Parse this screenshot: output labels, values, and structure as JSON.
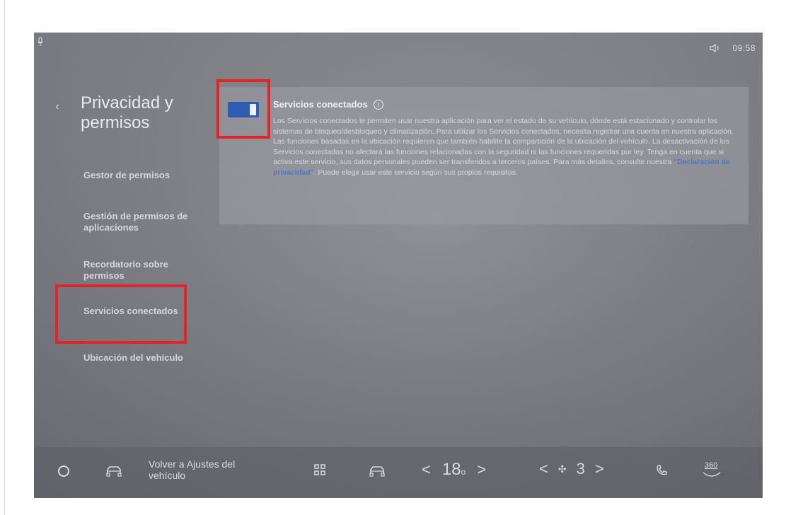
{
  "status": {
    "time": "09:58"
  },
  "sidebar": {
    "title": "Privacidad y permisos",
    "items": [
      {
        "label": "Gestor de permisos"
      },
      {
        "label": "Gestión de permisos de aplicaciones"
      },
      {
        "label": "Recordatorio sobre permisos"
      },
      {
        "label": "Servicios conectados"
      },
      {
        "label": "Ubicación del vehículo"
      }
    ]
  },
  "content": {
    "title": "Servicios conectados",
    "toggle_state": true,
    "description_before": "Los Servicios conectados le permiten usar nuestra aplicación para ver el estado de su vehículo, dónde está estacionado y controlar los sistemas de bloqueo/desbloqueo y climatización. Para utilizar los Servicios conectados, necesita registrar una cuenta en nuestra aplicación. Las funciones basadas en la ubicación requieren que también habilite la compartición de la ubicación del vehículo. La desactivación de los Servicios conectados no afectará las funciones relacionadas con la seguridad ni las funciones requeridas por ley. Tenga en cuenta que si activa este servicio, sus datos personales pueden ser transferidos a terceros países. Para más detalles, consulte nuestra ",
    "privacy_link": "\"Declaración de privacidad\"",
    "description_after": ". Puede elegir usar este servicio según sus propios requisitos."
  },
  "navbar": {
    "back_label": "Volver a Ajustes del vehículo",
    "temp_left_arrow": "<",
    "temperature": "18",
    "temp_unit": "o",
    "temp_right_arrow": ">",
    "fan_left_arrow": "<",
    "fan_level": "3",
    "fan_right_arrow": ">",
    "camera_label": "360"
  },
  "colors": {
    "highlight": "#e5242a",
    "toggle_on": "#2f5db3",
    "link": "#4b78c9"
  },
  "icons": [
    "microphone-icon",
    "volume-icon",
    "back-chevron-icon",
    "info-icon",
    "home-icon",
    "car-icon",
    "apps-grid-icon",
    "seat-icon",
    "fan-icon",
    "phone-icon",
    "camera-360-icon"
  ]
}
